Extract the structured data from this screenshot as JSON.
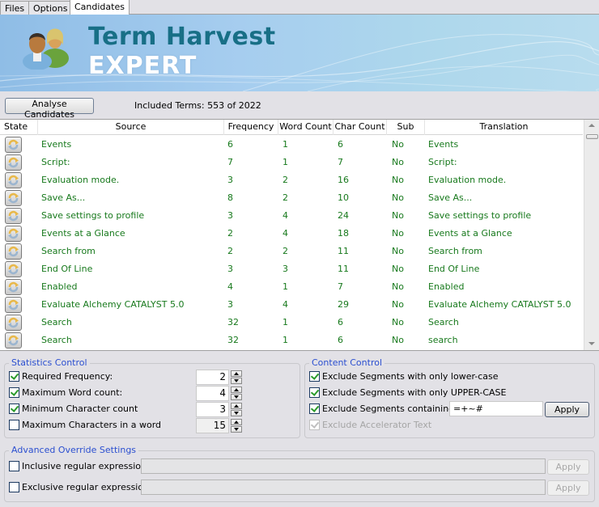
{
  "tabs": [
    {
      "label": "Files",
      "active": false
    },
    {
      "label": "Options",
      "active": false
    },
    {
      "label": "Candidates",
      "active": true
    }
  ],
  "banner": {
    "title_line1": "Term Harvest",
    "title_line2": "EXPERT",
    "icon": "people-icon"
  },
  "toolbar": {
    "analyse_label": "Analyse Candidates",
    "included_terms": "Included Terms: 553 of 2022"
  },
  "grid": {
    "columns": [
      "State",
      "Source",
      "Frequency",
      "Word Count",
      "Char Count",
      "Sub",
      "Translation"
    ],
    "state_icon": "refresh-icon",
    "text_color": "#17791c",
    "rows": [
      {
        "source": "Events",
        "frequency": "6",
        "word_count": "1",
        "char_count": "6",
        "sub": "No",
        "translation": "Events"
      },
      {
        "source": "Script:",
        "frequency": "7",
        "word_count": "1",
        "char_count": "7",
        "sub": "No",
        "translation": "Script:"
      },
      {
        "source": "Evaluation mode.",
        "frequency": "3",
        "word_count": "2",
        "char_count": "16",
        "sub": "No",
        "translation": "Evaluation mode."
      },
      {
        "source": "Save As...",
        "frequency": "8",
        "word_count": "2",
        "char_count": "10",
        "sub": "No",
        "translation": "Save As..."
      },
      {
        "source": "Save settings to profile",
        "frequency": "3",
        "word_count": "4",
        "char_count": "24",
        "sub": "No",
        "translation": "Save settings to profile"
      },
      {
        "source": "Events at a Glance",
        "frequency": "2",
        "word_count": "4",
        "char_count": "18",
        "sub": "No",
        "translation": "Events at a Glance"
      },
      {
        "source": "Search from",
        "frequency": "2",
        "word_count": "2",
        "char_count": "11",
        "sub": "No",
        "translation": "Search from"
      },
      {
        "source": "End Of Line",
        "frequency": "3",
        "word_count": "3",
        "char_count": "11",
        "sub": "No",
        "translation": "End Of Line"
      },
      {
        "source": "Enabled",
        "frequency": "4",
        "word_count": "1",
        "char_count": "7",
        "sub": "No",
        "translation": "Enabled"
      },
      {
        "source": "Evaluate Alchemy CATALYST 5.0",
        "frequency": "3",
        "word_count": "4",
        "char_count": "29",
        "sub": "No",
        "translation": "Evaluate Alchemy CATALYST 5.0"
      },
      {
        "source": "Search",
        "frequency": "32",
        "word_count": "1",
        "char_count": "6",
        "sub": "No",
        "translation": "Search"
      },
      {
        "source": "Search",
        "frequency": "32",
        "word_count": "1",
        "char_count": "6",
        "sub": "No",
        "translation": "search"
      }
    ]
  },
  "statistics_control": {
    "title": "Statistics Control",
    "items": [
      {
        "label": "Required Frequency:",
        "checked": true,
        "value": "2",
        "enabled": true
      },
      {
        "label": "Maximum Word count:",
        "checked": true,
        "value": "4",
        "enabled": true
      },
      {
        "label": "Minimum Character count",
        "checked": true,
        "value": "3",
        "enabled": true
      },
      {
        "label": "Maximum Characters in a word",
        "checked": false,
        "value": "15",
        "enabled": false
      }
    ]
  },
  "content_control": {
    "title": "Content Control",
    "items": [
      {
        "label": "Exclude Segments with only lower-case",
        "checked": true,
        "enabled": true
      },
      {
        "label": "Exclude Segments with only UPPER-CASE",
        "checked": true,
        "enabled": true
      },
      {
        "label": "Exclude Segments containing",
        "checked": true,
        "enabled": true
      },
      {
        "label": "Exclude Accelerator Text",
        "checked": true,
        "enabled": false
      }
    ],
    "containing_value": "=+~#",
    "apply_label": "Apply"
  },
  "advanced": {
    "title": "Advanced Override Settings",
    "items": [
      {
        "label": "Inclusive regular expression:",
        "checked": false,
        "value": "",
        "apply_label": "Apply"
      },
      {
        "label": "Exclusive regular expression:",
        "checked": false,
        "value": "",
        "apply_label": "Apply"
      }
    ]
  }
}
